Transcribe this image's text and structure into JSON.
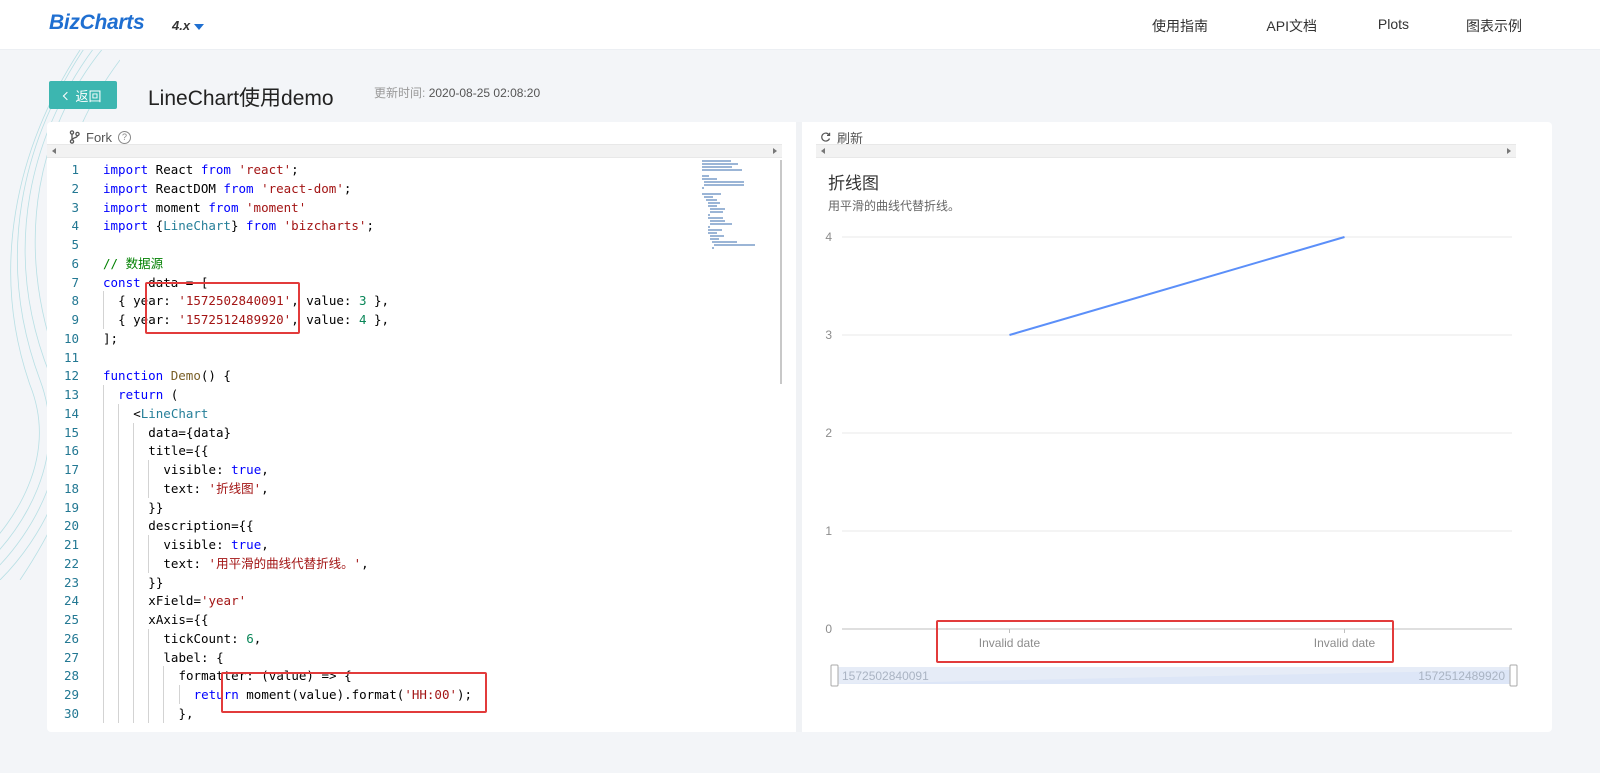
{
  "nav": {
    "logo": "BizCharts",
    "version": "4.x",
    "links": [
      "使用指南",
      "API文档",
      "Plots",
      "图表示例"
    ]
  },
  "header": {
    "back_label": "返回",
    "title": "LineChart使用demo",
    "update_label": "更新时间:",
    "update_time": "2020-08-25 02:08:20"
  },
  "editor": {
    "fork_label": "Fork",
    "help_glyph": "?",
    "lines": [
      {
        "n": "1",
        "indent": 0,
        "tokens": [
          [
            "kw",
            "import"
          ],
          [
            "t",
            " React "
          ],
          [
            "kw",
            "from"
          ],
          [
            "t",
            " "
          ],
          [
            "str",
            "'react'"
          ],
          [
            "t",
            ";"
          ]
        ]
      },
      {
        "n": "2",
        "indent": 0,
        "tokens": [
          [
            "kw",
            "import"
          ],
          [
            "t",
            " ReactDOM "
          ],
          [
            "kw",
            "from"
          ],
          [
            "t",
            " "
          ],
          [
            "str",
            "'react-dom'"
          ],
          [
            "t",
            ";"
          ]
        ]
      },
      {
        "n": "3",
        "indent": 0,
        "tokens": [
          [
            "kw",
            "import"
          ],
          [
            "t",
            " moment "
          ],
          [
            "kw",
            "from"
          ],
          [
            "t",
            " "
          ],
          [
            "str",
            "'moment'"
          ]
        ]
      },
      {
        "n": "4",
        "indent": 0,
        "tokens": [
          [
            "kw",
            "import"
          ],
          [
            "t",
            " {"
          ],
          [
            "ty",
            "LineChart"
          ],
          [
            "t",
            "} "
          ],
          [
            "kw",
            "from"
          ],
          [
            "t",
            " "
          ],
          [
            "str",
            "'bizcharts'"
          ],
          [
            "t",
            ";"
          ]
        ]
      },
      {
        "n": "5",
        "indent": 0,
        "tokens": []
      },
      {
        "n": "6",
        "indent": 0,
        "tokens": [
          [
            "cm",
            "// 数据源"
          ]
        ]
      },
      {
        "n": "7",
        "indent": 0,
        "tokens": [
          [
            "kw",
            "const"
          ],
          [
            "t",
            " data = ["
          ]
        ]
      },
      {
        "n": "8",
        "indent": 1,
        "tokens": [
          [
            "t",
            "{ year: "
          ],
          [
            "str",
            "'1572502840091'"
          ],
          [
            "t",
            ", value: "
          ],
          [
            "num",
            "3"
          ],
          [
            "t",
            " },"
          ]
        ]
      },
      {
        "n": "9",
        "indent": 1,
        "tokens": [
          [
            "t",
            "{ year: "
          ],
          [
            "str",
            "'1572512489920'"
          ],
          [
            "t",
            ", value: "
          ],
          [
            "num",
            "4"
          ],
          [
            "t",
            " },"
          ]
        ]
      },
      {
        "n": "10",
        "indent": 0,
        "tokens": [
          [
            "t",
            "];"
          ]
        ]
      },
      {
        "n": "11",
        "indent": 0,
        "tokens": []
      },
      {
        "n": "12",
        "indent": 0,
        "tokens": [
          [
            "kw",
            "function"
          ],
          [
            "t",
            " "
          ],
          [
            "fn",
            "Demo"
          ],
          [
            "t",
            "() {"
          ]
        ]
      },
      {
        "n": "13",
        "indent": 1,
        "tokens": [
          [
            "kw",
            "return"
          ],
          [
            "t",
            " ("
          ]
        ]
      },
      {
        "n": "14",
        "indent": 2,
        "tokens": [
          [
            "t",
            "<"
          ],
          [
            "ty",
            "LineChart"
          ]
        ]
      },
      {
        "n": "15",
        "indent": 3,
        "tokens": [
          [
            "t",
            "data={data}"
          ]
        ]
      },
      {
        "n": "16",
        "indent": 3,
        "tokens": [
          [
            "t",
            "title={{"
          ]
        ]
      },
      {
        "n": "17",
        "indent": 4,
        "tokens": [
          [
            "t",
            "visible: "
          ],
          [
            "kw",
            "true"
          ],
          [
            "t",
            ","
          ]
        ]
      },
      {
        "n": "18",
        "indent": 4,
        "tokens": [
          [
            "t",
            "text: "
          ],
          [
            "str",
            "'折线图'"
          ],
          [
            "t",
            ","
          ]
        ]
      },
      {
        "n": "19",
        "indent": 3,
        "tokens": [
          [
            "t",
            "}}"
          ]
        ]
      },
      {
        "n": "20",
        "indent": 3,
        "tokens": [
          [
            "t",
            "description={{"
          ]
        ]
      },
      {
        "n": "21",
        "indent": 4,
        "tokens": [
          [
            "t",
            "visible: "
          ],
          [
            "kw",
            "true"
          ],
          [
            "t",
            ","
          ]
        ]
      },
      {
        "n": "22",
        "indent": 4,
        "tokens": [
          [
            "t",
            "text: "
          ],
          [
            "str",
            "'用平滑的曲线代替折线。'"
          ],
          [
            "t",
            ","
          ]
        ]
      },
      {
        "n": "23",
        "indent": 3,
        "tokens": [
          [
            "t",
            "}}"
          ]
        ]
      },
      {
        "n": "24",
        "indent": 3,
        "tokens": [
          [
            "t",
            "xField="
          ],
          [
            "str",
            "'year'"
          ]
        ]
      },
      {
        "n": "25",
        "indent": 3,
        "tokens": [
          [
            "t",
            "xAxis={{"
          ]
        ]
      },
      {
        "n": "26",
        "indent": 4,
        "tokens": [
          [
            "t",
            "tickCount: "
          ],
          [
            "num",
            "6"
          ],
          [
            "t",
            ","
          ]
        ]
      },
      {
        "n": "27",
        "indent": 4,
        "tokens": [
          [
            "t",
            "label: {"
          ]
        ]
      },
      {
        "n": "28",
        "indent": 5,
        "tokens": [
          [
            "t",
            "formatter: (value) => {"
          ]
        ]
      },
      {
        "n": "29",
        "indent": 6,
        "tokens": [
          [
            "kw",
            "return"
          ],
          [
            "t",
            " moment(value).format("
          ],
          [
            "str",
            "'HH:00'"
          ],
          [
            "t",
            ");"
          ]
        ]
      },
      {
        "n": "30",
        "indent": 5,
        "tokens": [
          [
            "t",
            "},"
          ]
        ]
      }
    ]
  },
  "preview": {
    "refresh_label": "刷新",
    "chart_title": "折线图",
    "chart_desc": "用平滑的曲线代替折线。",
    "slider_start": "1572502840091",
    "slider_end": "1572512489920"
  },
  "colors": {
    "accent": "#3cb6b0",
    "brand": "#1f6fd1",
    "line": "#5b8ff9",
    "highlight": "#e23b3b"
  },
  "chart_data": {
    "type": "line",
    "x": [
      "Invalid date",
      "Invalid date"
    ],
    "x_raw": [
      "1572502840091",
      "1572512489920"
    ],
    "series": [
      {
        "values": [
          3,
          4
        ]
      }
    ],
    "y_ticks": [
      0,
      1,
      2,
      3,
      4
    ],
    "ylim": [
      0,
      4
    ],
    "grid": true,
    "title": "折线图",
    "subtitle": "用平滑的曲线代替折线。"
  }
}
